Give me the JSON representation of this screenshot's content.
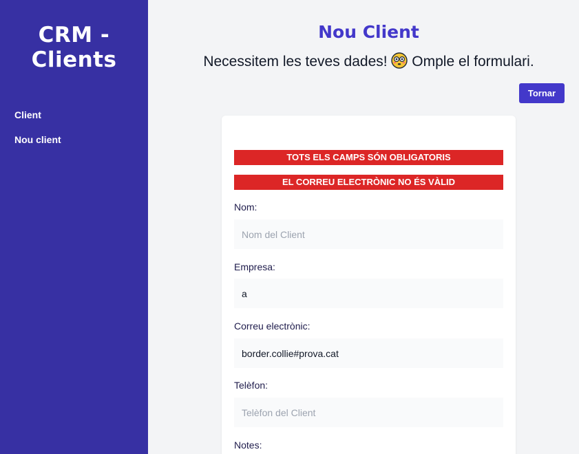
{
  "sidebar": {
    "brand": "CRM - Clients",
    "items": [
      {
        "label": "Client"
      },
      {
        "label": "Nou client"
      }
    ]
  },
  "header": {
    "title": "Nou Client",
    "subtitle_before": "Necessitem les teves dades!",
    "subtitle_after": "Omple el formulari.",
    "emoji": "flushed-face-icon",
    "back_label": "Tornar"
  },
  "form": {
    "alerts": [
      "TOTS ELS CAMPS SÓN OBLIGATORIS",
      "EL CORREU ELECTRÒNIC NO ÉS VÀLID"
    ],
    "fields": [
      {
        "label": "Nom:",
        "value": "",
        "placeholder": "Nom del Client"
      },
      {
        "label": "Empresa:",
        "value": "a",
        "placeholder": ""
      },
      {
        "label": "Correu electrònic:",
        "value": "border.collie#prova.cat",
        "placeholder": ""
      },
      {
        "label": "Telèfon:",
        "value": "",
        "placeholder": "Telèfon del Client"
      },
      {
        "label": "Notes:",
        "value": "",
        "placeholder": ""
      }
    ]
  },
  "colors": {
    "sidebar": "#3730a3",
    "accent": "#4338ca",
    "alert": "#dc2626"
  }
}
